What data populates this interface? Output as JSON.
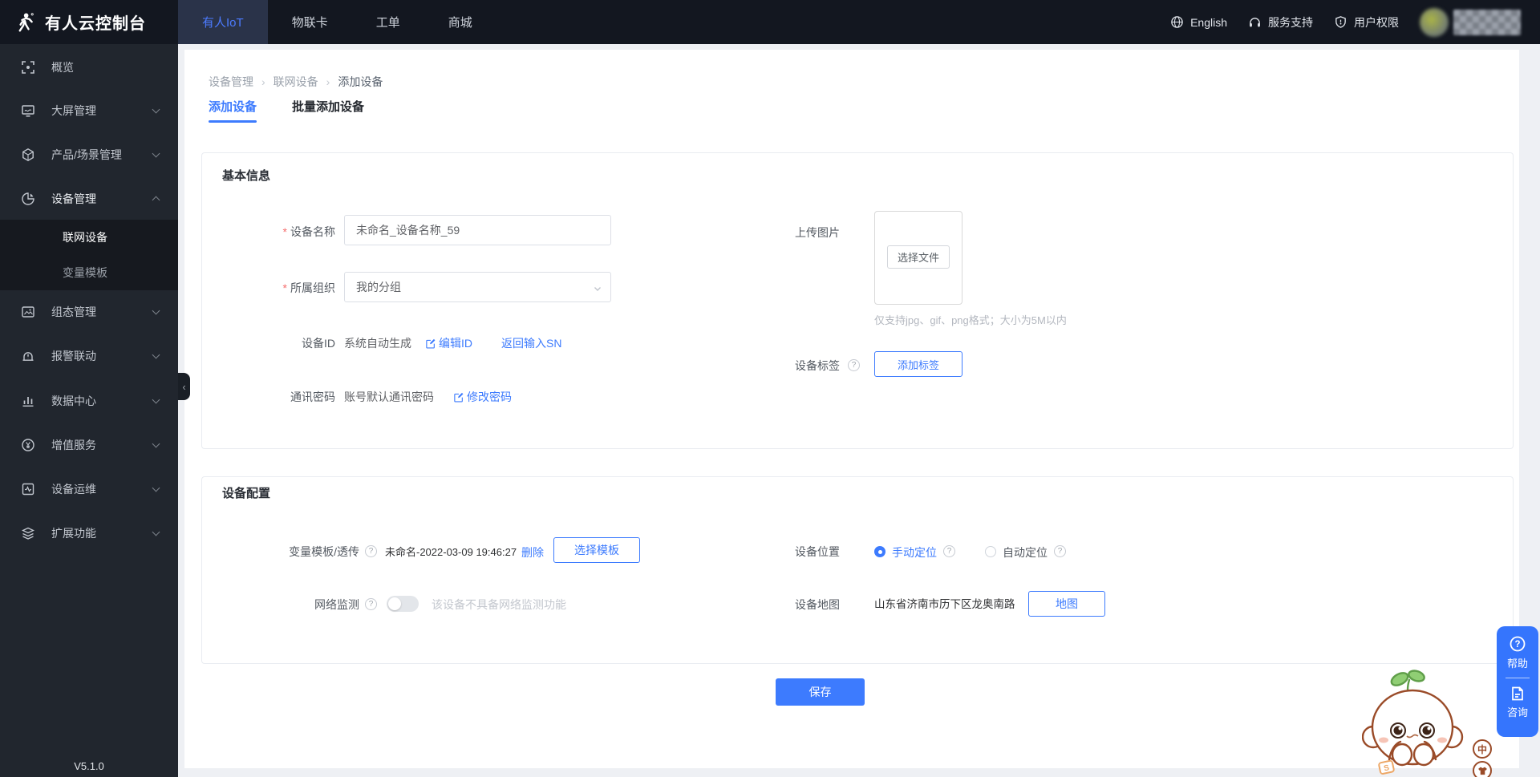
{
  "colors": {
    "accent": "#3D7BFE",
    "header_bg": "#131720",
    "sidebar_bg": "#21262E",
    "submenu_bg": "#16191F",
    "page_bg": "#EEF0F4",
    "link": "#3D7BFE",
    "save_button_bg": "#3D7BFE",
    "required_mark": "#F56C6C",
    "float_panel_bg": "#3575FD"
  },
  "header": {
    "logo_icon": "runner-logo-icon",
    "title": "有人云控制台",
    "nav_tabs": [
      {
        "label": "有人IoT",
        "active": true
      },
      {
        "label": "物联卡",
        "active": false
      },
      {
        "label": "工单",
        "active": false
      },
      {
        "label": "商城",
        "active": false
      }
    ],
    "right": [
      {
        "icon": "globe-icon",
        "label": "English"
      },
      {
        "icon": "headset-icon",
        "label": "服务支持"
      },
      {
        "icon": "shield-icon",
        "label": "用户权限"
      }
    ]
  },
  "sidebar": {
    "items": [
      {
        "label": "概览",
        "icon": "overview-icon",
        "chevron": ""
      },
      {
        "label": "大屏管理",
        "icon": "screen-icon",
        "chevron": "down"
      },
      {
        "label": "产品/场景管理",
        "icon": "cube-icon",
        "chevron": "down"
      },
      {
        "label": "设备管理",
        "icon": "pie-icon",
        "chevron": "up",
        "expanded": true
      },
      {
        "label": "组态管理",
        "icon": "image-icon",
        "chevron": "down"
      },
      {
        "label": "报警联动",
        "icon": "alarm-icon",
        "chevron": "down"
      },
      {
        "label": "数据中心",
        "icon": "bars-icon",
        "chevron": "down"
      },
      {
        "label": "增值服务",
        "icon": "yen-icon",
        "chevron": "down"
      },
      {
        "label": "设备运维",
        "icon": "monitor-pulse-icon",
        "chevron": "down"
      },
      {
        "label": "扩展功能",
        "icon": "layers-icon",
        "chevron": "down"
      }
    ],
    "submenu": [
      {
        "label": "联网设备",
        "active": true
      },
      {
        "label": "变量模板",
        "active": false
      }
    ],
    "collapse_glyph": "‹",
    "version": "V5.1.0"
  },
  "breadcrumb": {
    "items": [
      "设备管理",
      "联网设备",
      "添加设备"
    ],
    "separator": "›"
  },
  "page_tabs": [
    {
      "label": "添加设备",
      "active": true
    },
    {
      "label": "批量添加设备",
      "active": false
    }
  ],
  "required_mark": "*",
  "basic_info": {
    "title": "基本信息",
    "device_name_label": "设备名称",
    "device_name_value": "未命名_设备名称_59",
    "org_label": "所属组织",
    "org_value": "我的分组",
    "device_id_label": "设备ID",
    "device_id_value": "系统自动生成",
    "edit_id_link": "编辑ID",
    "sn_link": "返回输入SN",
    "password_label": "通讯密码",
    "password_value": "账号默认通讯密码",
    "change_password_link": "修改密码",
    "upload_label": "上传图片",
    "choose_file_button": "选择文件",
    "upload_tip": "仅支持jpg、gif、png格式；大小为5M以内",
    "tag_label": "设备标签",
    "add_tag_button": "添加标签"
  },
  "device_config": {
    "title": "设备配置",
    "template_label": "变量模板/透传",
    "template_value": "未命名-2022-03-09 19:46:27",
    "delete_link": "删除",
    "choose_template_button": "选择模板",
    "network_label": "网络监测",
    "network_tip": "该设备不具备网络监测功能",
    "location_label": "设备位置",
    "manual_option": "手动定位",
    "auto_option": "自动定位",
    "map_label": "设备地图",
    "map_value": "山东省济南市历下区龙奥南路",
    "map_button": "地图"
  },
  "save_button": "保存",
  "floating_panel": {
    "help": "帮助",
    "consult": "咨询"
  },
  "mascot_buttons": {
    "zhong": "中"
  }
}
